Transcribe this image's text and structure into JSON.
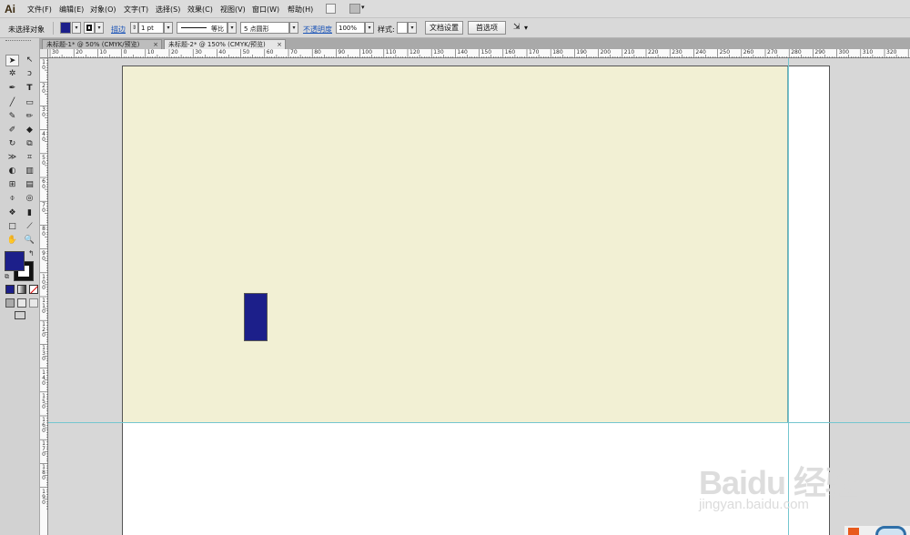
{
  "app": {
    "logo": "Ai"
  },
  "menu": [
    "文件(F)",
    "编辑(E)",
    "对象(O)",
    "文字(T)",
    "选择(S)",
    "效果(C)",
    "视图(V)",
    "窗口(W)",
    "帮助(H)"
  ],
  "control": {
    "no_selection": "未选择对象",
    "stroke_label": "描边",
    "stroke_weight": "1 pt",
    "stroke_profile": "等比",
    "brush": "5 点圆形",
    "opacity_label": "不透明度",
    "opacity_value": "100%",
    "style_label": "样式:",
    "doc_setup": "文档设置",
    "preferences": "首选项"
  },
  "tabs": [
    {
      "label": "未标题-1* @ 50% (CMYK/预览)",
      "close": "×",
      "active": false
    },
    {
      "label": "未标题-2* @ 150% (CMYK/预览)",
      "close": "×",
      "active": true
    }
  ],
  "ruler": {
    "top": [
      "30",
      "20",
      "10",
      "0",
      "10",
      "20",
      "30",
      "40",
      "50",
      "60",
      "70",
      "80",
      "90",
      "100",
      "110",
      "120",
      "130",
      "140",
      "150",
      "160",
      "170",
      "180",
      "190",
      "200",
      "210",
      "220",
      "230",
      "240",
      "250",
      "260",
      "270",
      "280",
      "290",
      "300",
      "310",
      "320",
      "330",
      "340"
    ],
    "left": [
      "1\n0",
      "2\n0",
      "3\n0",
      "4\n0",
      "5\n0",
      "6\n0",
      "7\n0",
      "8\n0",
      "9\n0",
      "1\n0\n0",
      "1\n1\n0",
      "1\n2\n0",
      "1\n3\n0",
      "1\n4\n0",
      "1\n5\n0",
      "1\n6\n0",
      "1\n7\n0",
      "1\n8\n0",
      "1\n9\n0"
    ]
  },
  "tools": [
    "selection-tool",
    "direct-selection-tool",
    "magic-wand-tool",
    "lasso-tool",
    "pen-tool",
    "type-tool",
    "line-segment-tool",
    "rectangle-tool",
    "paintbrush-tool",
    "pencil-tool",
    "blob-brush-tool",
    "eraser-tool",
    "rotate-tool",
    "scale-tool",
    "width-tool",
    "free-transform-tool",
    "shape-builder-tool",
    "perspective-grid-tool",
    "mesh-tool",
    "gradient-tool",
    "eyedropper-tool",
    "blend-tool",
    "symbol-sprayer-tool",
    "column-graph-tool",
    "artboard-tool",
    "slice-tool",
    "hand-tool",
    "zoom-tool"
  ],
  "colors": {
    "fill": "#1c1f8a",
    "background_rect": "#f2f0d4",
    "guide": "#74c6cf"
  },
  "watermark": {
    "main": "Baidu 经验",
    "sub": "jingyan.baidu.com"
  }
}
